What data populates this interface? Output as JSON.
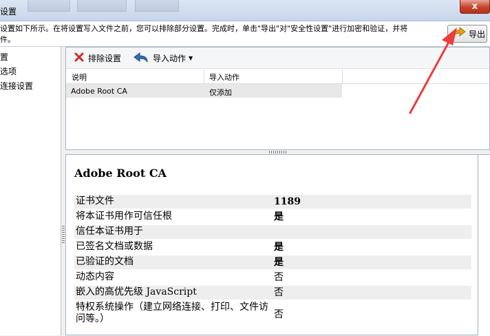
{
  "window": {
    "title": "设置",
    "close_label": "x"
  },
  "info": {
    "text": "设置如下所示。在将设置写入文件之前，您可以排除部分设置。完成时，单击\"导出\"对\"安全性设置\"进行加密和验证，并将\n件。"
  },
  "export_button": {
    "label": "导出"
  },
  "tree": {
    "items": [
      {
        "label": "置"
      },
      {
        "label": "选项"
      },
      {
        "label": "连接设置"
      }
    ]
  },
  "toolbar": {
    "remove_label": "排除设置",
    "import_action_label": "导入动作"
  },
  "grid": {
    "columns": [
      "说明",
      "导入动作"
    ],
    "rows": [
      {
        "description": "Adobe Root CA",
        "action": "仅添加"
      }
    ]
  },
  "detail": {
    "title": "Adobe Root CA",
    "properties": [
      {
        "key": "证书文件",
        "value": "1189",
        "strong": true
      },
      {
        "key": "将本证书用作可信任根",
        "value": "是",
        "strong": true
      },
      {
        "key": "信任本证书用于",
        "value": ""
      },
      {
        "key": "已签名文档或数据",
        "value": "是",
        "strong": true
      },
      {
        "key": "已验证的文档",
        "value": "是",
        "strong": true
      },
      {
        "key": "动态内容",
        "value": "否"
      },
      {
        "key": "嵌入的高优先级 JavaScript",
        "value": "否"
      },
      {
        "key": "特权系统操作（建立网络连接、打印、文件访问等。）",
        "value": "否"
      }
    ]
  },
  "colors": {
    "arrow": "#ee3b3b",
    "remove_icon": "#d22a2a",
    "export_icon": "#e9a10c"
  }
}
